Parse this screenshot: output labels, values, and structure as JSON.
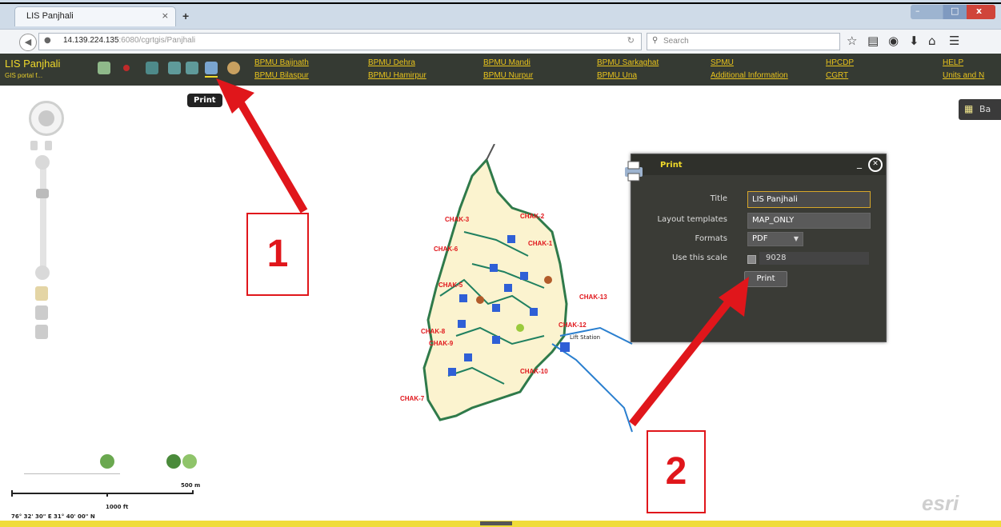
{
  "browser": {
    "tab_title": "LIS Panjhali",
    "tab_close": "×",
    "new_tab": "+",
    "url_host": "14.139.224.135",
    "url_path": ":6080/cgrtgis/Panjhali",
    "search_placeholder": "Search",
    "window_controls": [
      "–",
      "□",
      "x"
    ]
  },
  "app": {
    "title": "LIS Panjhali",
    "subtitle": "GIS portal f...",
    "links": [
      [
        "BPMU Baijnath",
        "BPMU Bilaspur"
      ],
      [
        "BPMU Dehra",
        "BPMU Hamirpur"
      ],
      [
        "BPMU Mandi",
        "BPMU Nurpur"
      ],
      [
        "BPMU Sarkaghat",
        "BPMU Una"
      ],
      [
        "SPMU",
        "Additional Information"
      ],
      [
        "HPCDP",
        "CGRT"
      ],
      [
        "HELP",
        "Units and N"
      ]
    ],
    "tooltip": "Print",
    "basemap_label": "Ba"
  },
  "print_dialog": {
    "header": "Print",
    "fields": {
      "title_label": "Title",
      "title_value": "LIS Panjhali",
      "layout_label": "Layout templates",
      "layout_value": "MAP_ONLY",
      "format_label": "Formats",
      "format_value": "PDF",
      "scale_label": "Use this scale",
      "scale_value": "9028"
    },
    "print_button": "Print"
  },
  "map": {
    "labels": [
      "CHAK-3",
      "CHAK-2",
      "CHAK-6",
      "CHAK-1",
      "CHAK-5",
      "CHAK-13",
      "CHAK-12",
      "CHAK-8",
      "CHAK-9",
      "CHAK-10",
      "CHAK-7"
    ],
    "pump_label": "Lift Station"
  },
  "annotations": {
    "step1": "1",
    "step2": "2"
  },
  "legend": {
    "scale_500": "500 m",
    "scale_1000": "1000 ft",
    "coords": "76° 32' 30\" E 31° 40' 00\" N",
    "esri": "esri"
  },
  "colors": {
    "toolbar_bg": "#353a33",
    "link": "#e8c31c",
    "arrow": "#e0161b"
  }
}
